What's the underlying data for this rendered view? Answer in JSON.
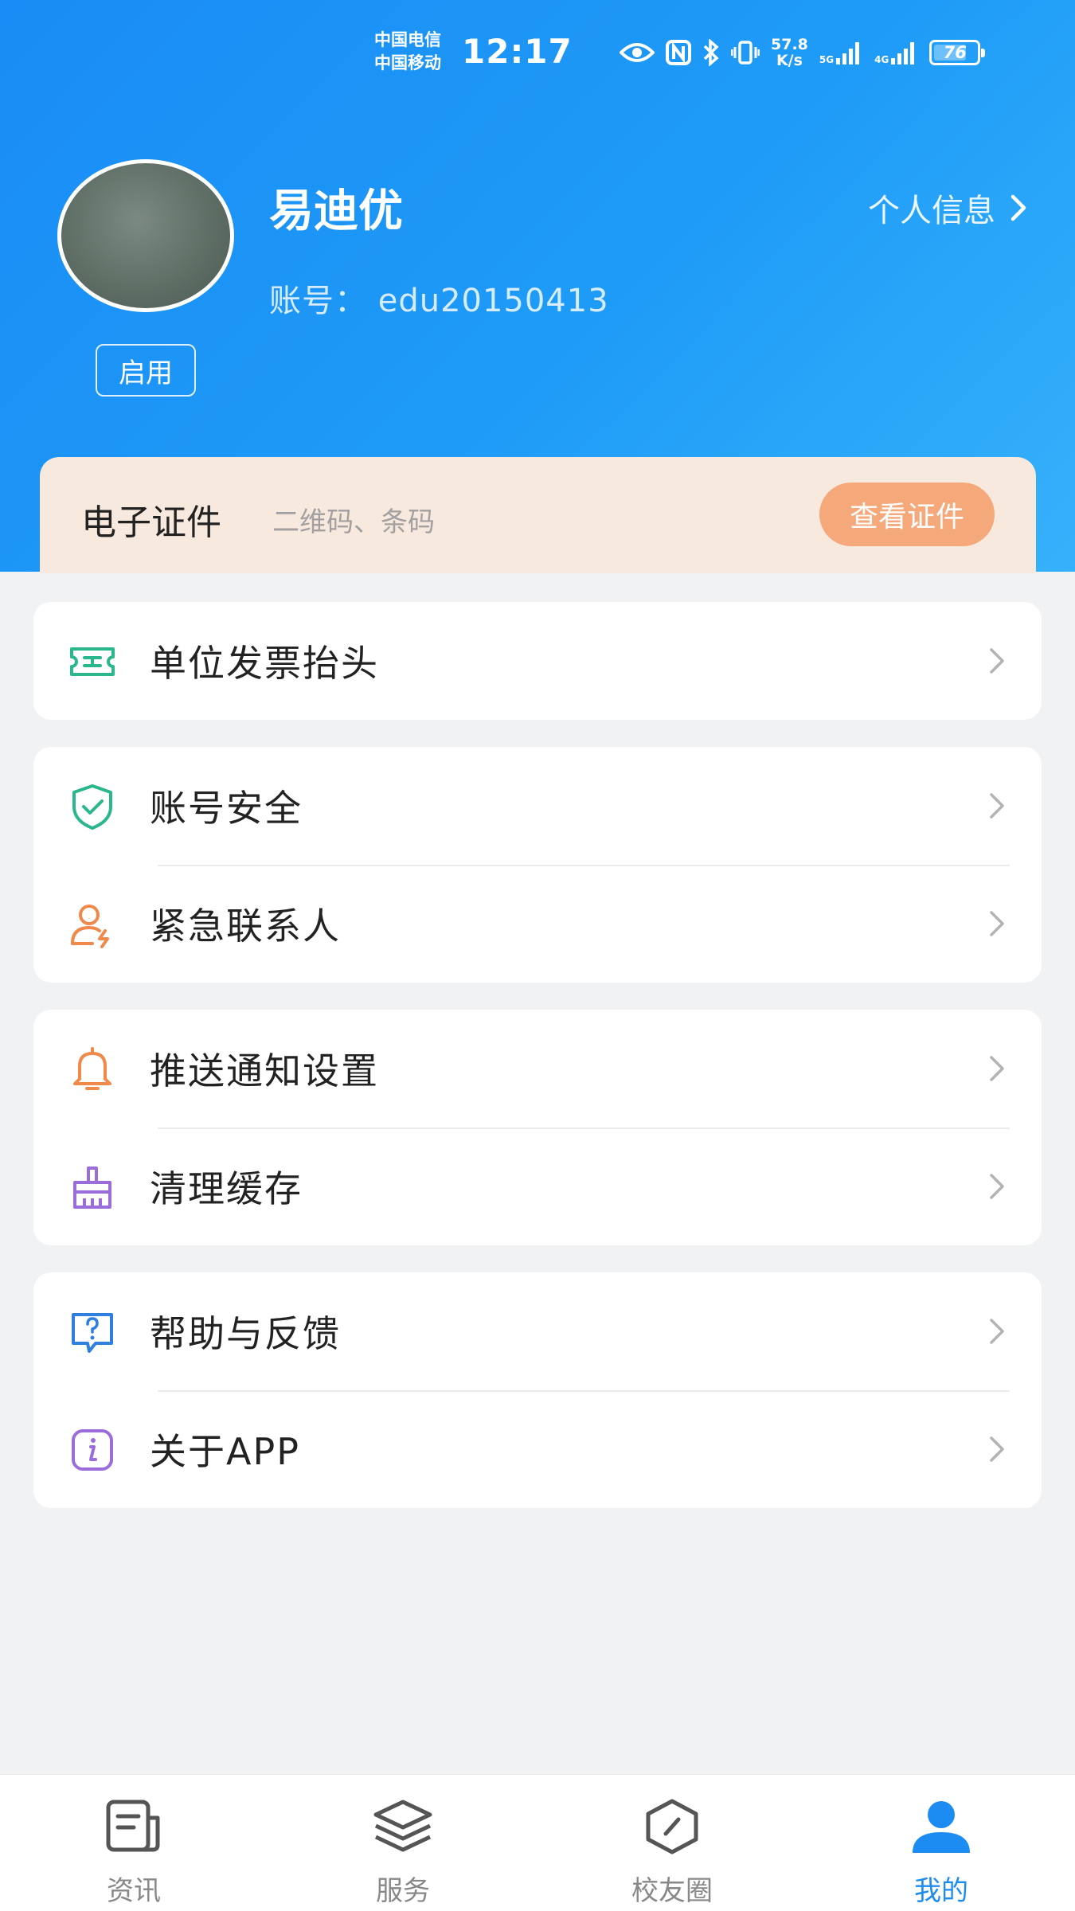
{
  "status_bar": {
    "carrier_1": "中国电信",
    "carrier_2": "中国移动",
    "time": "12:17",
    "net_speed_value": "57.8",
    "net_speed_unit": "K/s",
    "signal_1_label": "5G",
    "signal_2_label": "4G",
    "battery_level": "76"
  },
  "profile": {
    "name": "易迪优",
    "account_line": "账号： edu20150413",
    "status_tag": "启用",
    "info_link_label": "个人信息"
  },
  "cert_card": {
    "title": "电子证件",
    "subtitle": "二维码、条码",
    "button_label": "查看证件"
  },
  "menu_groups": [
    {
      "items": [
        {
          "label": "单位发票抬头",
          "icon": "invoice-icon",
          "color": "#2bb78e"
        }
      ]
    },
    {
      "items": [
        {
          "label": "账号安全",
          "icon": "shield-icon",
          "color": "#2bb78e"
        },
        {
          "label": "紧急联系人",
          "icon": "emergency-contact-icon",
          "color": "#f08a4b"
        }
      ]
    },
    {
      "items": [
        {
          "label": "推送通知设置",
          "icon": "bell-icon",
          "color": "#f08a4b"
        },
        {
          "label": "清理缓存",
          "icon": "broom-icon",
          "color": "#9b6ddb"
        }
      ]
    },
    {
      "items": [
        {
          "label": "帮助与反馈",
          "icon": "help-icon",
          "color": "#2f7fe0"
        },
        {
          "label": "关于APP",
          "icon": "info-icon",
          "color": "#9b6ddb"
        }
      ]
    }
  ],
  "tabbar": {
    "tabs": [
      {
        "label": "资讯",
        "icon": "news-icon",
        "active": false
      },
      {
        "label": "服务",
        "icon": "layers-icon",
        "active": false
      },
      {
        "label": "校友圈",
        "icon": "alumni-icon",
        "active": false
      },
      {
        "label": "我的",
        "icon": "person-icon",
        "active": true
      }
    ]
  },
  "colors": {
    "header_gradient_start": "#1a8cf5",
    "header_gradient_end": "#36b1fb",
    "cert_card_bg": "#f8e9de",
    "cert_button_bg": "#f5a879",
    "active_tab": "#1d8cf2"
  }
}
